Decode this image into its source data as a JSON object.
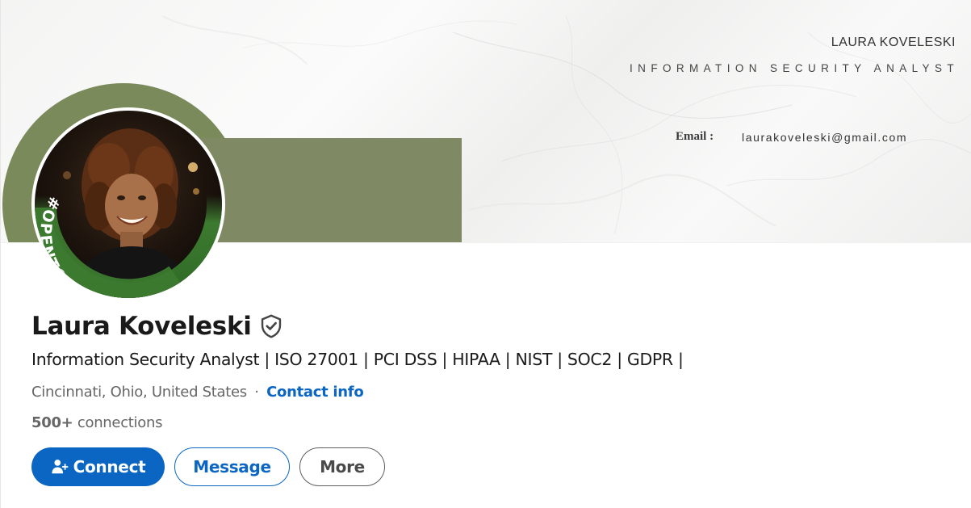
{
  "banner": {
    "name": "LAURA KOVELESKI",
    "title": "INFORMATION SECURITY ANALYST",
    "email_label": "Email :",
    "email_value": "laurakoveleski@gmail.com",
    "colors": {
      "arch": "#7b8a5b",
      "panel": "#7f8a64",
      "marble": "#f4f4f3"
    }
  },
  "avatar": {
    "badge_text": "#OPENTOWORK",
    "badge_color": "#3f7a32",
    "alt": "profile-photo"
  },
  "profile": {
    "name": "Laura Koveleski",
    "verified_icon": "verified-shield-icon",
    "headline": "Information Security Analyst | ISO 27001 | PCI DSS | HIPAA | NIST | SOC2 | GDPR |",
    "location": "Cincinnati, Ohio, United States",
    "separator": "·",
    "contact_info": "Contact info",
    "connections_count": "500+",
    "connections_label": "connections"
  },
  "actions": {
    "connect_label": "Connect",
    "connect_icon": "add-person-icon",
    "message_label": "Message",
    "more_label": "More"
  },
  "colors": {
    "primary": "#0a66c2",
    "text": "#1a1a1a",
    "muted": "#666666"
  }
}
